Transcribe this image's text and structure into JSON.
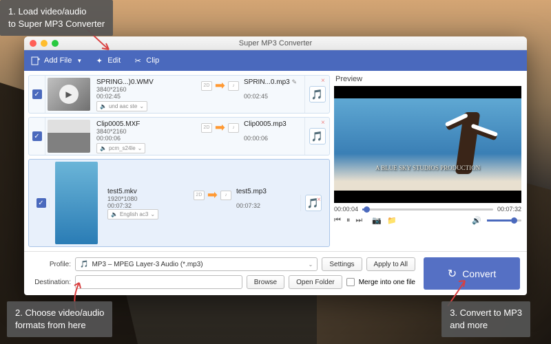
{
  "callouts": {
    "c1": "1. Load video/audio\nto Super MP3 Converter",
    "c2": "2. Choose video/audio\nformats from here",
    "c3": "3. Convert to MP3\nand more"
  },
  "window": {
    "title": "Super MP3 Converter"
  },
  "toolbar": {
    "add_file": "Add File",
    "edit": "Edit",
    "clip": "Clip"
  },
  "items": [
    {
      "src_name": "SPRING...)0.WMV",
      "resolution": "3840*2160",
      "duration": "00:02:45",
      "dst_name": "SPRIN...0.mp3",
      "dst_duration": "00:02:45",
      "audio_track": "und aac ste",
      "editable": true,
      "play_overlay": true
    },
    {
      "src_name": "Clip0005.MXF",
      "resolution": "3840*2160",
      "duration": "00:00:06",
      "dst_name": "Clip0005.mp3",
      "dst_duration": "00:00:06",
      "audio_track": "pcm_s24le",
      "editable": false,
      "play_overlay": false
    },
    {
      "src_name": "test5.mkv",
      "resolution": "1920*1080",
      "duration": "00:07:32",
      "dst_name": "test5.mp3",
      "dst_duration": "00:07:32",
      "audio_track": "English ac3",
      "editable": false,
      "play_overlay": false
    }
  ],
  "preview": {
    "title": "Preview",
    "frame_text": "A BLUE SKY STUDIOS PRODUCTION",
    "time_current": "00:00:04",
    "time_total": "00:07:32"
  },
  "footer": {
    "profile_label": "Profile:",
    "profile_value": "MP3 – MPEG Layer-3 Audio (*.mp3)",
    "settings": "Settings",
    "apply_all": "Apply to All",
    "destination_label": "Destination:",
    "browse": "Browse",
    "open_folder": "Open Folder",
    "merge": "Merge into one file",
    "convert": "Convert"
  },
  "colors": {
    "primary": "#4a69bd",
    "accent": "#ff9933"
  }
}
